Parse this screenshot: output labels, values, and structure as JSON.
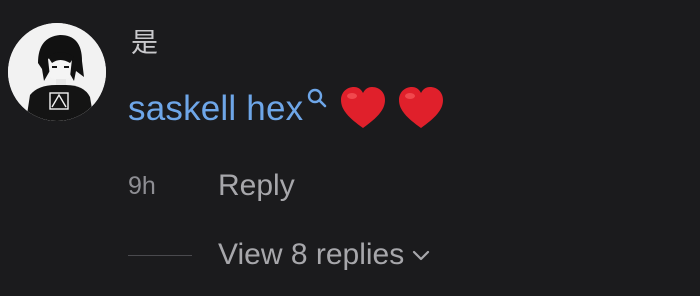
{
  "comment": {
    "author": "是",
    "mention": "saskell hex",
    "reactions": [
      "heart",
      "heart"
    ],
    "timestamp": "9h",
    "reply_label": "Reply",
    "view_replies_label": "View 8 replies"
  },
  "colors": {
    "background": "#1b1b1d",
    "mention": "#6ea6e8",
    "heart": "#e0202b",
    "secondary_text": "#a7a7ab"
  },
  "icons": [
    "search-icon",
    "heart-icon",
    "chevron-down-icon"
  ]
}
